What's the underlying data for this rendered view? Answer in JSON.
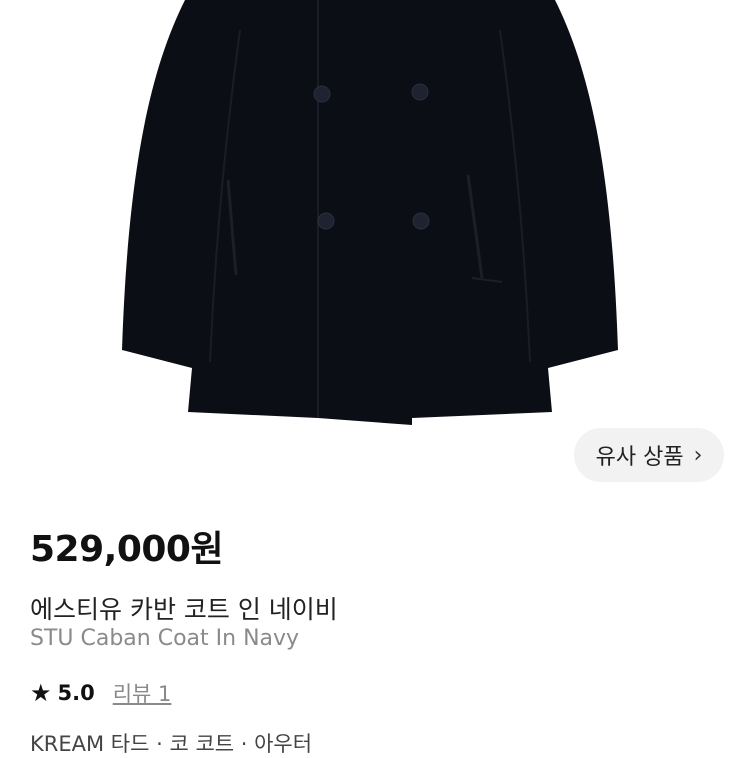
{
  "product": {
    "image_alt": "STU Caban Coat In Navy",
    "similar_button": {
      "label": "유사 상품",
      "icon": "chevron-right-icon"
    },
    "price": "529,000원",
    "name_ko": "에스티유 카반 코트 인 네이비",
    "name_en": "STU Caban Coat In Navy",
    "rating": {
      "icon": "star-icon",
      "score": "5.0",
      "reviews": "리뷰 1"
    },
    "breadcrumb": "KREAM 타드 · 코 코트 · 아우터"
  },
  "colors": {
    "coat": "#0c0e15",
    "button_bg": "#f2f2f2",
    "muted_text": "#8a8a8a"
  }
}
